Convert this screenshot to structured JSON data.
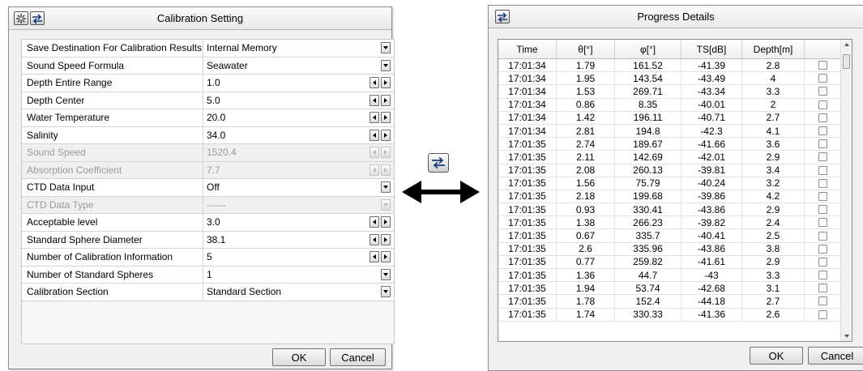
{
  "calibration_window": {
    "title": "Calibration Setting",
    "icons": [
      "settings-gear-icon",
      "swap-arrows-icon"
    ],
    "rows": [
      {
        "label": "Save Destination For Calibration Results",
        "value": "Internal Memory",
        "control": "dropdown",
        "enabled": true
      },
      {
        "label": "Sound Speed Formula",
        "value": "Seawater",
        "control": "dropdown",
        "enabled": true
      },
      {
        "label": "Depth Entire Range",
        "value": "1.0",
        "control": "stepper",
        "enabled": true
      },
      {
        "label": "Depth Center",
        "value": "5.0",
        "control": "stepper",
        "enabled": true
      },
      {
        "label": "Water Temperature",
        "value": "20.0",
        "control": "stepper",
        "enabled": true
      },
      {
        "label": "Salinity",
        "value": "34.0",
        "control": "stepper",
        "enabled": true
      },
      {
        "label": "Sound Speed",
        "value": "1520.4",
        "control": "stepper",
        "enabled": false
      },
      {
        "label": "Absorption Coefficient",
        "value": "7.7",
        "control": "stepper",
        "enabled": false
      },
      {
        "label": "CTD Data Input",
        "value": "Off",
        "control": "dropdown",
        "enabled": true
      },
      {
        "label": "CTD Data Type",
        "value": "------",
        "control": "dropdown",
        "enabled": false
      },
      {
        "label": "Acceptable level",
        "value": "3.0",
        "control": "stepper",
        "enabled": true
      },
      {
        "label": "Standard Sphere Diameter",
        "value": "38.1",
        "control": "stepper",
        "enabled": true
      },
      {
        "label": "Number of Calibration Information",
        "value": "5",
        "control": "stepper",
        "enabled": true
      },
      {
        "label": "Number of Standard Spheres",
        "value": "1",
        "control": "dropdown",
        "enabled": true
      },
      {
        "label": "Calibration Section",
        "value": "Standard Section",
        "control": "dropdown",
        "enabled": true
      }
    ],
    "ok_label": "OK",
    "cancel_label": "Cancel"
  },
  "connector": {
    "icon": "swap-arrows-icon",
    "arrow": "double-headed-arrow"
  },
  "progress_window": {
    "title": "Progress Details",
    "icon": "swap-arrows-icon",
    "columns": [
      "Time",
      "θ[°]",
      "φ[°]",
      "TS[dB]",
      "Depth[m]",
      ""
    ],
    "rows": [
      [
        "17:01:34",
        "1.79",
        "161.52",
        "-41.39",
        "2.8"
      ],
      [
        "17:01:34",
        "1.95",
        "143.54",
        "-43.49",
        "4"
      ],
      [
        "17:01:34",
        "1.53",
        "269.71",
        "-43.34",
        "3.3"
      ],
      [
        "17:01:34",
        "0.86",
        "8.35",
        "-40.01",
        "2"
      ],
      [
        "17:01:34",
        "1.42",
        "196.11",
        "-40.71",
        "2.7"
      ],
      [
        "17:01:34",
        "2.81",
        "194.8",
        "-42.3",
        "4.1"
      ],
      [
        "17:01:35",
        "2.74",
        "189.67",
        "-41.66",
        "3.6"
      ],
      [
        "17:01:35",
        "2.11",
        "142.69",
        "-42.01",
        "2.9"
      ],
      [
        "17:01:35",
        "2.08",
        "260.13",
        "-39.81",
        "3.4"
      ],
      [
        "17:01:35",
        "1.56",
        "75.79",
        "-40.24",
        "3.2"
      ],
      [
        "17:01:35",
        "2.18",
        "199.68",
        "-39.86",
        "4.2"
      ],
      [
        "17:01:35",
        "0.93",
        "330.41",
        "-43.86",
        "2.9"
      ],
      [
        "17:01:35",
        "1.38",
        "266.23",
        "-39.82",
        "2.4"
      ],
      [
        "17:01:35",
        "0.67",
        "335.7",
        "-40.41",
        "2.5"
      ],
      [
        "17:01:35",
        "2.6",
        "335.96",
        "-43.86",
        "3.8"
      ],
      [
        "17:01:35",
        "0.77",
        "259.82",
        "-41.61",
        "2.9"
      ],
      [
        "17:01:35",
        "1.36",
        "44.7",
        "-43",
        "3.3"
      ],
      [
        "17:01:35",
        "1.94",
        "53.74",
        "-42.68",
        "3.1"
      ],
      [
        "17:01:35",
        "1.78",
        "152.4",
        "-44.18",
        "2.7"
      ],
      [
        "17:01:35",
        "1.74",
        "330.33",
        "-41.36",
        "2.6"
      ]
    ],
    "ok_label": "OK",
    "cancel_label": "Cancel"
  }
}
